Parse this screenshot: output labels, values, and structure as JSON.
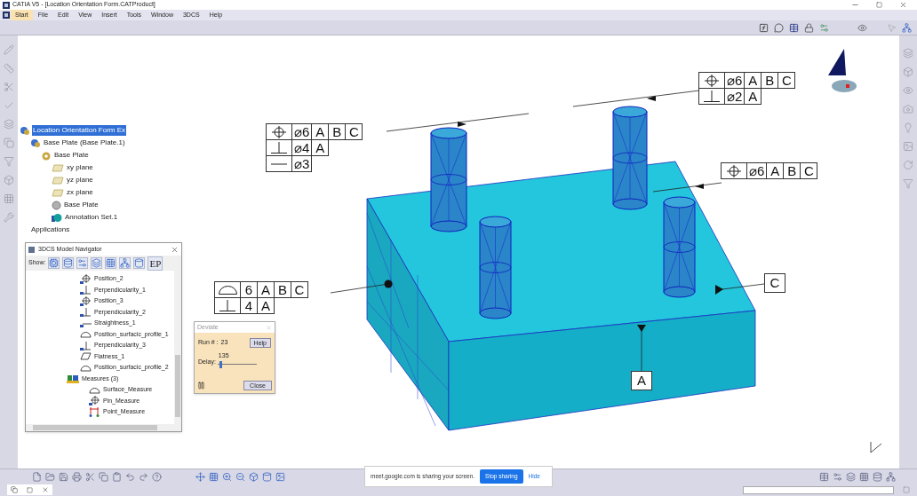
{
  "window": {
    "title": "CATIA V5 - [Location Orientation Form.CATProduct]"
  },
  "menu": [
    {
      "label": "Start",
      "selected": true
    },
    {
      "label": "File",
      "selected": false
    },
    {
      "label": "Edit",
      "selected": false
    },
    {
      "label": "View",
      "selected": false
    },
    {
      "label": "Insert",
      "selected": false
    },
    {
      "label": "Tools",
      "selected": false
    },
    {
      "label": "Window",
      "selected": false
    },
    {
      "label": "3DCS",
      "selected": false
    },
    {
      "label": "Help",
      "selected": false
    }
  ],
  "tree": [
    {
      "label": "Location Orientation Form Ex",
      "kind": "product",
      "selected": true,
      "children": [
        {
          "label": "Base Plate (Base Plate.1)",
          "kind": "product",
          "selected": false,
          "children": [
            {
              "label": "Base Plate",
              "kind": "part",
              "selected": false,
              "children": [
                {
                  "label": "xy plane",
                  "kind": "plane",
                  "selected": false
                },
                {
                  "label": "yz plane",
                  "kind": "plane",
                  "selected": false
                },
                {
                  "label": "zx plane",
                  "kind": "plane",
                  "selected": false
                },
                {
                  "label": "Base Plate",
                  "kind": "body",
                  "selected": false
                },
                {
                  "label": "Annotation Set.1",
                  "kind": "annotation",
                  "selected": false
                }
              ]
            }
          ]
        },
        {
          "label": "Applications",
          "kind": "plain",
          "selected": false
        }
      ]
    }
  ],
  "navigator": {
    "title": "3DCS Model Navigator",
    "show_label": "Show:",
    "filter_text": "EP",
    "continued_children": [
      {
        "label": "Position_2",
        "kind": "position"
      },
      {
        "label": "Perpendicularity_1",
        "kind": "perpendicularity"
      },
      {
        "label": "Position_3",
        "kind": "position"
      },
      {
        "label": "Perpendicularity_2",
        "kind": "perpendicularity"
      },
      {
        "label": "Straightness_1",
        "kind": "straightness"
      },
      {
        "label": "Position_surfacic_profile_1",
        "kind": "profile"
      },
      {
        "label": "Perpendicularity_3",
        "kind": "perpendicularity"
      },
      {
        "label": "Flatness_1",
        "kind": "flatness"
      },
      {
        "label": "Position_surfacic_profile_2",
        "kind": "profile"
      }
    ],
    "nodes": [
      {
        "label": "Measures (3)",
        "kind": "folder",
        "children": [
          {
            "label": "Surface_Measure",
            "kind": "profile"
          },
          {
            "label": "Pin_Measure",
            "kind": "position"
          },
          {
            "label": "Point_Measure",
            "kind": "point"
          }
        ]
      }
    ]
  },
  "deviate": {
    "title": "Deviate",
    "run_label": "Run # :",
    "run_value": "23",
    "help_button": "Help",
    "delay_label": "Delay:",
    "delay_value": "135",
    "delay": {
      "level": 0.05
    },
    "close_button": "Close"
  },
  "annotations": {
    "frames": [
      {
        "rows": [
          [
            {
              "kind": "position"
            },
            {
              "kind": "text",
              "text": "⌀6"
            },
            {
              "kind": "text",
              "text": "A"
            },
            {
              "kind": "text",
              "text": "B"
            },
            {
              "kind": "text",
              "text": "C"
            }
          ],
          [
            {
              "kind": "perpendicularity"
            },
            {
              "kind": "text",
              "text": "⌀4"
            },
            {
              "kind": "text",
              "text": "A"
            }
          ],
          [
            {
              "kind": "straightness"
            },
            {
              "kind": "text",
              "text": "⌀3"
            }
          ]
        ]
      },
      {
        "rows": [
          [
            {
              "kind": "position"
            },
            {
              "kind": "text",
              "text": "⌀6"
            },
            {
              "kind": "text",
              "text": "A"
            },
            {
              "kind": "text",
              "text": "B"
            },
            {
              "kind": "text",
              "text": "C"
            }
          ],
          [
            {
              "kind": "perpendicularity"
            },
            {
              "kind": "text",
              "text": "⌀2"
            },
            {
              "kind": "text",
              "text": "A"
            }
          ]
        ]
      },
      {
        "rows": [
          [
            {
              "kind": "position"
            },
            {
              "kind": "text",
              "text": "⌀6"
            },
            {
              "kind": "text",
              "text": "A"
            },
            {
              "kind": "text",
              "text": "B"
            },
            {
              "kind": "text",
              "text": "C"
            }
          ]
        ]
      },
      {
        "rows": [
          [
            {
              "kind": "profile"
            },
            {
              "kind": "text",
              "text": "6"
            },
            {
              "kind": "text",
              "text": "A"
            },
            {
              "kind": "text",
              "text": "B"
            },
            {
              "kind": "text",
              "text": "C"
            }
          ],
          [
            {
              "kind": "perpendicularity"
            },
            {
              "kind": "text",
              "text": "4"
            },
            {
              "kind": "text",
              "text": "A"
            }
          ]
        ]
      }
    ],
    "datums": [
      {
        "label": "C"
      },
      {
        "label": "A"
      }
    ]
  },
  "share_bar": {
    "message": "meet.google.com is sharing your screen.",
    "stop_button": "Stop sharing",
    "hide_button": "Hide"
  }
}
